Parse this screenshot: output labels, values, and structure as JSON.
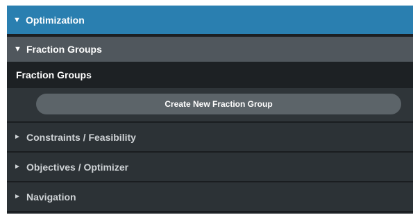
{
  "optimization": {
    "arrow": "▼",
    "title": "Optimization"
  },
  "fraction_groups": {
    "arrow": "▼",
    "title": "Fraction Groups",
    "subtitle": "Fraction Groups",
    "create_button_label": "Create New Fraction Group"
  },
  "sections": [
    {
      "arrow": "►",
      "label": "Constraints / Feasibility"
    },
    {
      "arrow": "►",
      "label": "Objectives / Optimizer"
    },
    {
      "arrow": "►",
      "label": "Navigation"
    }
  ],
  "colors": {
    "header_blue": "#2a7fb0",
    "group_header_gray": "#50575d",
    "button_gray": "#5c6469",
    "panel_dark": "#2c3236"
  }
}
